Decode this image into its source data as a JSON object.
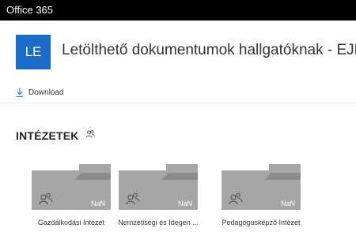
{
  "suite_bar": {
    "app_name": "Office 365"
  },
  "site": {
    "logo_initials": "LE",
    "title": "Letölthető dokumentumok hallgatóknak - EJF"
  },
  "command_bar": {
    "download_label": "Download"
  },
  "section": {
    "title": "INTÉZETEK",
    "icon": "people-icon"
  },
  "folders": [
    {
      "name": "Gazdálkodási Intézet",
      "count": "NaN"
    },
    {
      "name": "Nemzetiségi és Idegen ...",
      "count": "NaN"
    },
    {
      "name": "Pedagógusképző Intézet",
      "count": "NaN"
    }
  ],
  "colors": {
    "suite_bar": "#000000",
    "logo_bg": "#1b6cc8",
    "folder": "#a6a6a6"
  }
}
